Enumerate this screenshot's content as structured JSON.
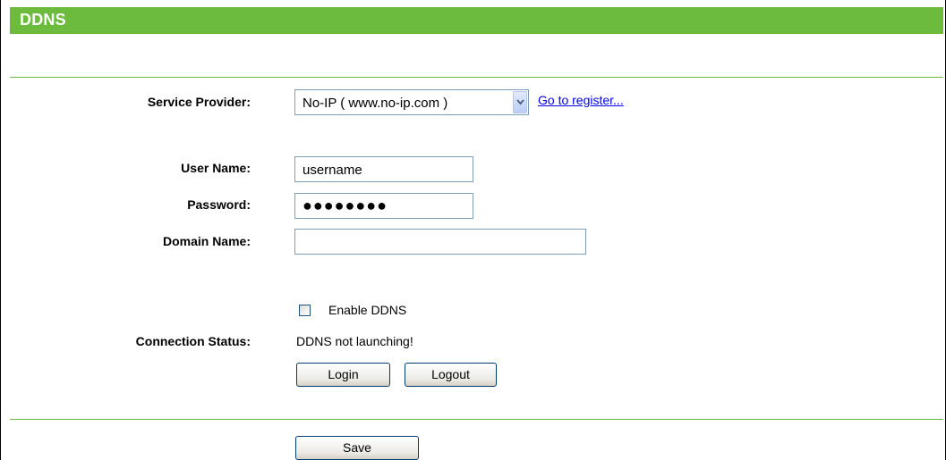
{
  "header": {
    "title": "DDNS"
  },
  "form": {
    "service_provider": {
      "label": "Service Provider:",
      "selected": "No-IP ( www.no-ip.com )",
      "register_link": "Go to register..."
    },
    "user_name": {
      "label": "User Name:",
      "value": "username"
    },
    "password": {
      "label": "Password:",
      "value": "●●●●●●●●"
    },
    "domain_name": {
      "label": "Domain Name:",
      "value": ""
    },
    "enable_ddns": {
      "label": "Enable DDNS",
      "checked": false
    },
    "connection_status": {
      "label": "Connection Status:",
      "value": "DDNS not launching!"
    },
    "buttons": {
      "login": "Login",
      "logout": "Logout",
      "save": "Save"
    }
  },
  "colors": {
    "header_green": "#6cbb3c",
    "link_blue": "#0000ee"
  }
}
